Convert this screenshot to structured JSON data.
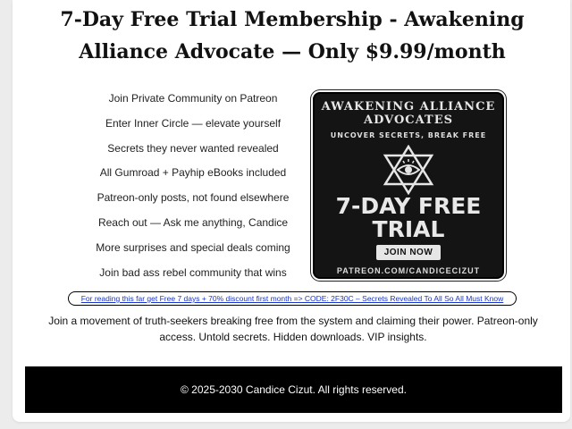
{
  "page": {
    "title": "7-Day Free Trial Membership - Awakening Alliance Advocate — Only $9.99/month"
  },
  "features": [
    "Join Private Community on Patreon",
    "Enter Inner Circle — elevate yourself",
    "Secrets they never wanted revealed",
    "All Gumroad + Payhip eBooks included",
    "Patreon-only posts, not found elsewhere",
    "Reach out — Ask me anything, Candice",
    "More surprises and special deals coming",
    "Join bad ass rebel community that wins"
  ],
  "promo": {
    "brand_line1": "AWAKENING ALLIANCE",
    "brand_line2": "ADVOCATES",
    "tagline": "UNCOVER SECRETS, BREAK FREE",
    "icon": "all-seeing-eye-star-icon",
    "headline1": "7-DAY FREE",
    "headline2": "TRIAL",
    "button": "JOIN NOW",
    "url": "PATREON.COM/CANDICECIZUT"
  },
  "discount_link": "For reading this far get Free 7 days + 70% discount first month => CODE: 2F30C – Secrets Revealed To All So All Must Know",
  "blurb": "Join a movement of truth-seekers breaking free from the system and claiming their power. Patreon-only access. Untold secrets. Hidden downloads. VIP insights.",
  "footer": "© 2025-2030 Candice Cizut. All rights reserved.",
  "colors": {
    "link": "#1a35c7",
    "footer_bg": "#000000",
    "promo_bg": "#141414"
  }
}
